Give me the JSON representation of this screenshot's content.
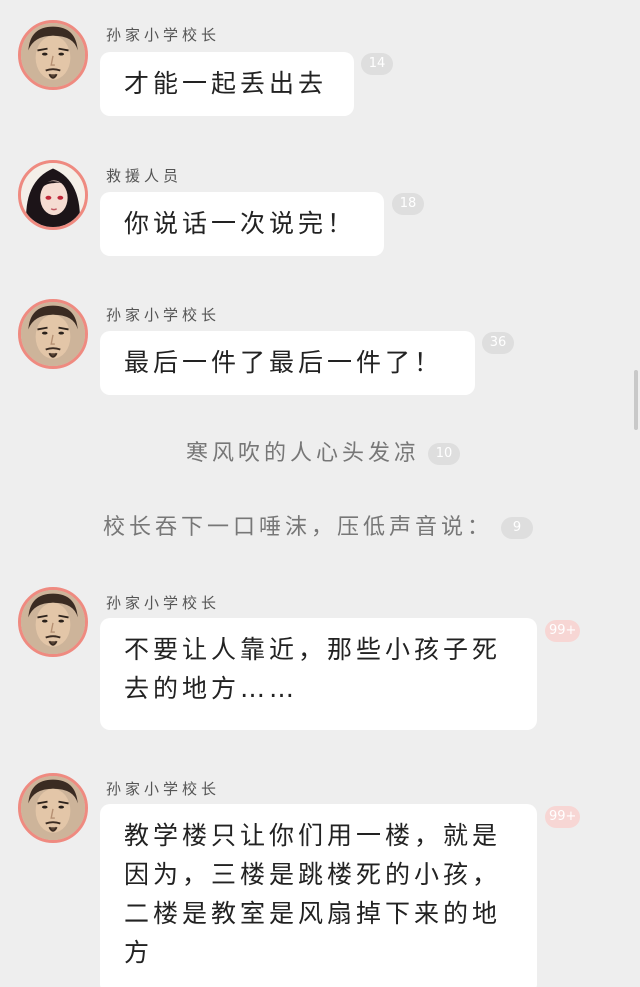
{
  "messages": [
    {
      "speaker": "孙家小学校长",
      "text": "才能一起丢出去",
      "count": "14"
    },
    {
      "speaker": "救援人员",
      "text": "你说话一次说完！",
      "count": "18"
    },
    {
      "speaker": "孙家小学校长",
      "text": "最后一件了最后一件了！",
      "count": "36"
    },
    {
      "speaker": "孙家小学校长",
      "text": "不要让人靠近，那些小孩子死去的地方……",
      "count": "99+"
    },
    {
      "speaker": "孙家小学校长",
      "text": "教学楼只让你们用一楼，就是因为，三楼是跳楼死的小孩，二楼是教室是风扇掉下来的地方",
      "count": "99+"
    }
  ],
  "narrations": [
    {
      "text": "寒风吹的人心头发凉",
      "count": "10"
    },
    {
      "text": "校长吞下一口唾沫，压低声音说：",
      "count": "9"
    }
  ],
  "colors": {
    "background": "#eeeeee",
    "bubble": "#ffffff",
    "avatar_ring": "#ef8a80",
    "badge": "#dedede",
    "badge_hot": "#f7d6d4"
  },
  "icons": {
    "principal_avatar": "man-portrait-icon",
    "rescuer_avatar": "woman-portrait-icon"
  }
}
